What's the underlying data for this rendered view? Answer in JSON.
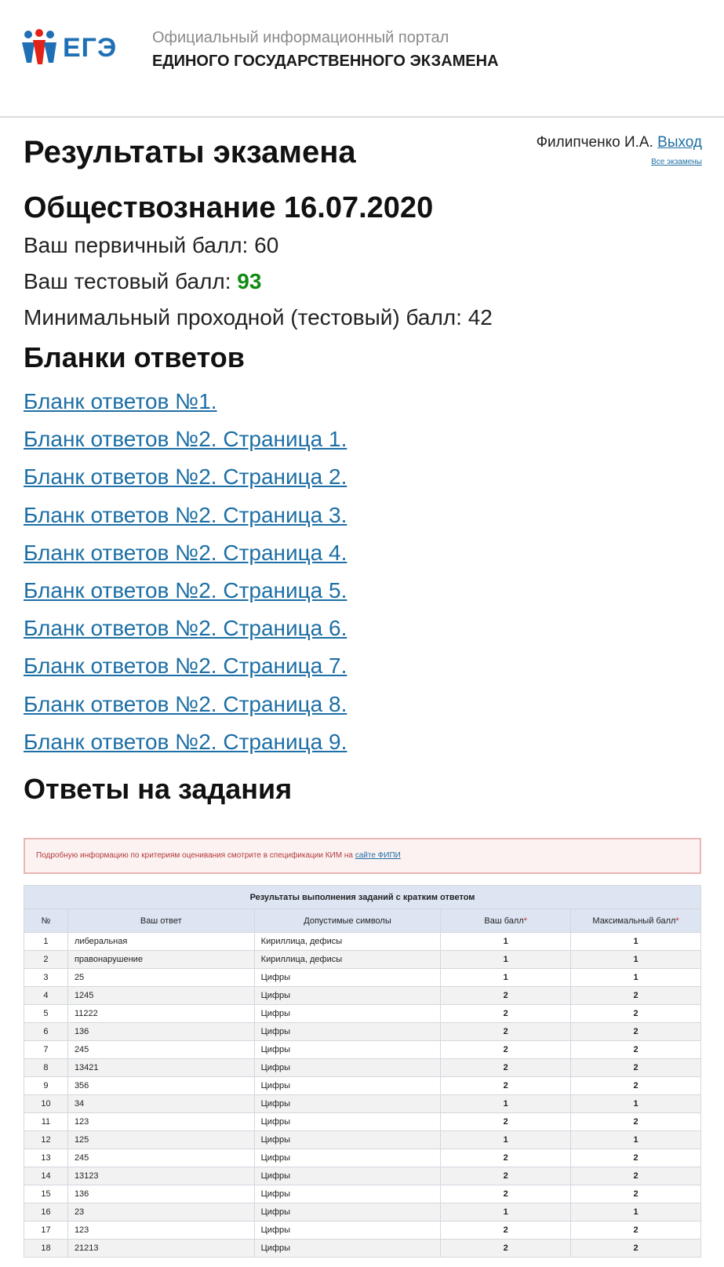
{
  "header": {
    "logo_text": "ЕГЭ",
    "portal_line1": "Официальный информационный портал",
    "portal_line2": "ЕДИНОГО ГОСУДАРСТВЕННОГО ЭКЗАМЕНА"
  },
  "user": {
    "name": "Филипченко И.А.",
    "logout_label": "Выход",
    "all_exams_label": "Все экзамены"
  },
  "page_title": "Результаты экзамена",
  "subject_title": "Обществознание 16.07.2020",
  "scores": {
    "primary_label": "Ваш первичный балл:",
    "primary_value": "60",
    "test_label": "Ваш тестовый балл:",
    "test_value": "93",
    "min_label": "Минимальный проходной (тестовый) балл:",
    "min_value": "42"
  },
  "forms_section_title": "Бланки ответов",
  "forms": [
    "Бланк ответов №1.",
    "Бланк ответов №2. Страница 1.",
    "Бланк ответов №2. Страница 2.",
    "Бланк ответов №2. Страница 3.",
    "Бланк ответов №2. Страница 4.",
    "Бланк ответов №2. Страница 5.",
    "Бланк ответов №2. Страница 6.",
    "Бланк ответов №2. Страница 7.",
    "Бланк ответов №2. Страница 8.",
    "Бланк ответов №2. Страница 9."
  ],
  "answers_section_title": "Ответы на задания",
  "notice": {
    "text": "Подробную информацию по критериям оценивания смотрите в спецификации КИМ на",
    "link": "сайте ФИПИ"
  },
  "table": {
    "caption": "Результаты выполнения заданий с кратким ответом",
    "columns": {
      "num": "№",
      "answer": "Ваш ответ",
      "allowed": "Допустимые символы",
      "score": "Ваш балл",
      "max": "Максимальный балл",
      "required_mark": "*"
    },
    "rows": [
      {
        "num": "1",
        "answer": "либеральная",
        "allowed": "Кириллица, дефисы",
        "score": "1",
        "max": "1"
      },
      {
        "num": "2",
        "answer": "правонарушение",
        "allowed": "Кириллица, дефисы",
        "score": "1",
        "max": "1"
      },
      {
        "num": "3",
        "answer": "25",
        "allowed": "Цифры",
        "score": "1",
        "max": "1"
      },
      {
        "num": "4",
        "answer": "1245",
        "allowed": "Цифры",
        "score": "2",
        "max": "2"
      },
      {
        "num": "5",
        "answer": "11222",
        "allowed": "Цифры",
        "score": "2",
        "max": "2"
      },
      {
        "num": "6",
        "answer": "136",
        "allowed": "Цифры",
        "score": "2",
        "max": "2"
      },
      {
        "num": "7",
        "answer": "245",
        "allowed": "Цифры",
        "score": "2",
        "max": "2"
      },
      {
        "num": "8",
        "answer": "13421",
        "allowed": "Цифры",
        "score": "2",
        "max": "2"
      },
      {
        "num": "9",
        "answer": "356",
        "allowed": "Цифры",
        "score": "2",
        "max": "2"
      },
      {
        "num": "10",
        "answer": "34",
        "allowed": "Цифры",
        "score": "1",
        "max": "1"
      },
      {
        "num": "11",
        "answer": "123",
        "allowed": "Цифры",
        "score": "2",
        "max": "2"
      },
      {
        "num": "12",
        "answer": "125",
        "allowed": "Цифры",
        "score": "1",
        "max": "1"
      },
      {
        "num": "13",
        "answer": "245",
        "allowed": "Цифры",
        "score": "2",
        "max": "2"
      },
      {
        "num": "14",
        "answer": "13123",
        "allowed": "Цифры",
        "score": "2",
        "max": "2"
      },
      {
        "num": "15",
        "answer": "136",
        "allowed": "Цифры",
        "score": "2",
        "max": "2"
      },
      {
        "num": "16",
        "answer": "23",
        "allowed": "Цифры",
        "score": "1",
        "max": "1"
      },
      {
        "num": "17",
        "answer": "123",
        "allowed": "Цифры",
        "score": "2",
        "max": "2"
      },
      {
        "num": "18",
        "answer": "21213",
        "allowed": "Цифры",
        "score": "2",
        "max": "2"
      }
    ]
  },
  "colors": {
    "link": "#1d6fa5",
    "test_score": "#128a12",
    "logo_blue": "#1f6fb5",
    "logo_red": "#e2231a",
    "table_header": "#dde5f3",
    "notice_bg": "#fdf2f2",
    "notice_border": "#e8b6b6"
  }
}
